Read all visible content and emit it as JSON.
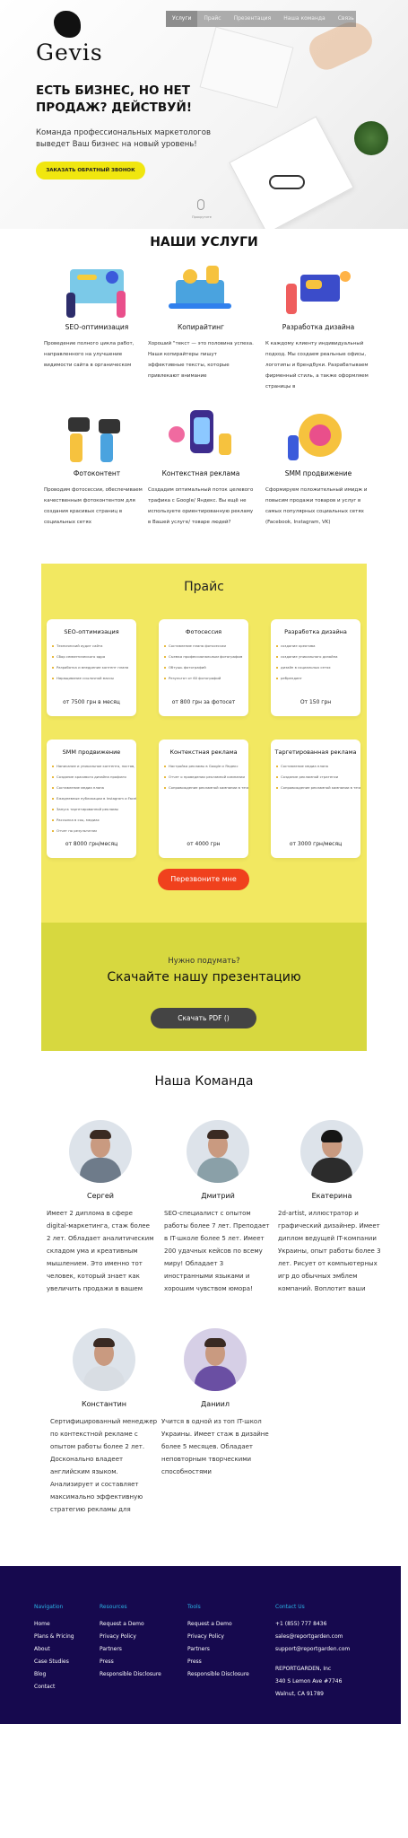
{
  "header": {
    "logo_text": "Gevis",
    "nav": [
      "Услуги",
      "Прайс",
      "Презентация",
      "Наша команда",
      "Связь"
    ]
  },
  "hero": {
    "title": "ЕСТЬ БИЗНЕС, НО НЕТ ПРОДАЖ? ДЕЙСТВУЙ!",
    "subtitle": "Команда профессиональных маркетологов выведет Ваш бизнес на новый уровень!",
    "cta": "ЗАКАЗАТЬ ОБРАТНЫЙ ЗВОНОК",
    "scroll_label": "Прокрутите"
  },
  "services": {
    "title": "НАШИ УСЛУГИ",
    "items": [
      {
        "name": "SEO-оптимизация",
        "desc": "Проведение полного цикла работ, направленного на улучшение видимости сайта в органическом"
      },
      {
        "name": "Копирайтинг",
        "desc": "Хороший \"текст — это половина успеха. Наши копирайтеры пишут эффективные тексты, которые привлекают внимание"
      },
      {
        "name": "Разработка дизайна",
        "desc": "К каждому клиенту индивидуальный подход. Мы создаем реальные офисы, логотипы и брендбуки. Разрабатываем фирменный стиль, а также оформляем страницы в"
      },
      {
        "name": "Фотоконтент",
        "desc": "Проводим фотосессии, обеспечиваем качественным фотоконтентом для создания красивых страниц в социальных сетях"
      },
      {
        "name": "Контекстная реклама",
        "desc": "Создадим оптимальный поток целевого трафика с Google/ Яндекс. Вы ещё не используете ориентированную рекламу в Вашей услуге/ товаре людей?"
      },
      {
        "name": "SMM продвижение",
        "desc": "Сформируем положительный имидж и повысим продажи товаров и услуг в самых популярных социальных сетях (Facebook, Instagram, VK)"
      }
    ]
  },
  "pricing": {
    "title": "Прайс",
    "cards": [
      {
        "title": "SEO-оптимизация",
        "items": [
          "Технический аудит сайта",
          "Сбор семантического ядра",
          "Разработка и внедрение контент плана",
          "Наращивание ссылочной массы"
        ],
        "price": "от 7500 грн в месяц"
      },
      {
        "title": "Фотосессия",
        "items": [
          "Составление плана фотосессии",
          "Съемка профессиональным фотографом",
          "Обтушь фотографий",
          "Результат от 60 фотографий"
        ],
        "price": "от 800 грн за фотосет"
      },
      {
        "title": "Разработка дизайна",
        "items": [
          "создание креатива",
          "создание уникального дизайна",
          "дизайн в социальных сетях",
          "ребрендинг"
        ],
        "price": "От 150 грн"
      },
      {
        "title": "SMM продвижение",
        "items": [
          "Написание и уникальное контента, постов, пилотов",
          "Создание красивого дизайна профиля",
          "Составление медиа плана",
          "Ежедневные публикации в Instagram и Facebook",
          "Запуск таргетированной рекламы",
          "Рассылка в соц. медиах",
          "Отчет по результатам"
        ],
        "price": "от 8000 грн/месяц"
      },
      {
        "title": "Контекстная реклама",
        "items": [
          "Настройка рекламы в Google и Яндекс",
          "Отчет о проведении рекламной кампании",
          "Сопровождение рекламной кампании в течение месяца"
        ],
        "price": "от 4000 грн"
      },
      {
        "title": "Таргетированная реклама",
        "items": [
          "Составление медиа плана",
          "Создание рекламной стратегии",
          "Сопровождение рекламной кампании в течение месяца"
        ],
        "price": "от 3000 грн/месяц"
      }
    ],
    "cta": "Перезвоните мне"
  },
  "presentation": {
    "question": "Нужно подумать?",
    "heading": "Скачайте нашу презентацию",
    "button": "Скачать PDF ()"
  },
  "team": {
    "title": "Наша Команда",
    "members": [
      {
        "name": "Сергей",
        "desc": "Имеет 2 диплома в сфере digital-маркетинга, стаж более 2 лет. Обладает аналитическим складом ума и креативным мышлением. Это именно тот человек, который знает как увеличить продажи в вашем"
      },
      {
        "name": "Дмитрий",
        "desc": "SEO-специалист с опытом работы более 7 лет. Преподает в IT-школе более 5 лет. Имеет 200 удачных кейсов по всему миру! Обладает 3 иностранными языками и хорошим чувством юмора!"
      },
      {
        "name": "Екатерина",
        "desc": "2d-artist, иллюстратор и графический дизайнер. Имеет диплом ведущей IT-компании Украины, опыт работы более 3 лет. Рисует от компьютерных игр до обычных эмблем компаний. Воплотит ваши"
      },
      {
        "name": "Константин",
        "desc": "Сертифицированный менеджер по контекстной рекламе с опытом работы более 2 лет. Досконально владеет английским языком. Анализирует и составляет максимально эффективную стратегию рекламы для"
      },
      {
        "name": "Даниил",
        "desc": "Учится в одной из топ IT-школ Украины. Имеет стаж в дизайне более 5 месяцев. Обладает неповторным творческими способностями"
      }
    ]
  },
  "footer": {
    "columns": [
      {
        "heading": "Navigation",
        "links": [
          "Home",
          "Plans & Pricing",
          "About",
          "Case Studies",
          "Blog",
          "Contact"
        ]
      },
      {
        "heading": "Resources",
        "links": [
          "Request a Demo",
          "Privacy Policy",
          "Partners",
          "Press",
          "Responsible Disclosure"
        ]
      },
      {
        "heading": "Tools",
        "links": [
          "Request a Demo",
          "Privacy Policy",
          "Partners",
          "Press",
          "Responsible Disclosure"
        ]
      },
      {
        "heading": "Contact Us",
        "links": [
          "+1 (855) 777 8436",
          "sales@reportgarden.com",
          "support@reportgarden.com",
          "",
          "REPORTGARDEN, Inc",
          "340 S Lemon Ave #7746",
          "Walnut, CA 91789"
        ]
      }
    ]
  },
  "colors": {
    "accent_yellow": "#f2e861",
    "cta_red": "#f0411d",
    "footer_bg": "#16094e",
    "footer_heading": "#2ab3e6"
  }
}
